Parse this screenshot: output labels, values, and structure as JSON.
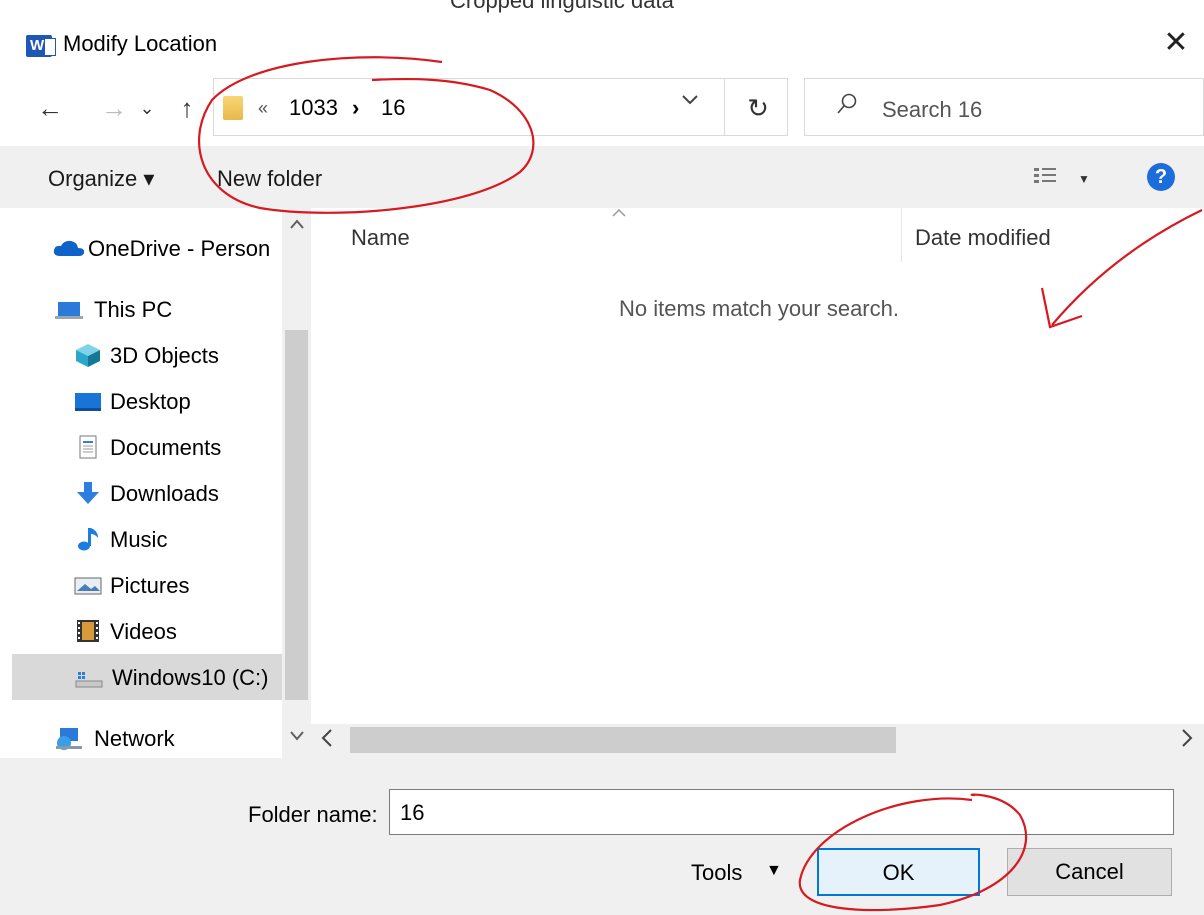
{
  "background": {
    "behind_text": "Cropped linguistic data"
  },
  "titlebar": {
    "title": "Modify Location",
    "app_icon": "word-icon",
    "close": "✕"
  },
  "nav": {
    "back": "←",
    "forward": "→",
    "recent": "⌄",
    "up": "↑",
    "breadcrumb": {
      "overflow": "«",
      "segment1": "1033",
      "separator": "›",
      "segment2": "16"
    },
    "dropdown": "⌄",
    "refresh": "↻",
    "search_placeholder": "Search 16"
  },
  "toolbar": {
    "organize": "Organize ▾",
    "new_folder": "New folder",
    "help": "?"
  },
  "sidebar": {
    "items": [
      {
        "label": "OneDrive - Person",
        "icon": "cloud-icon"
      },
      {
        "label": "This PC",
        "icon": "computer-icon"
      },
      {
        "label": "3D Objects",
        "icon": "cube-icon"
      },
      {
        "label": "Desktop",
        "icon": "desktop-icon"
      },
      {
        "label": "Documents",
        "icon": "documents-icon"
      },
      {
        "label": "Downloads",
        "icon": "download-icon"
      },
      {
        "label": "Music",
        "icon": "music-icon"
      },
      {
        "label": "Pictures",
        "icon": "pictures-icon"
      },
      {
        "label": "Videos",
        "icon": "videos-icon"
      },
      {
        "label": "Windows10 (C:)",
        "icon": "drive-icon"
      },
      {
        "label": "Network",
        "icon": "network-icon"
      }
    ],
    "selected": "Windows10 (C:)"
  },
  "content": {
    "columns": [
      "Name",
      "Date modified"
    ],
    "empty_message": "No items match your search."
  },
  "footer": {
    "folder_name_label": "Folder name:",
    "folder_name_value": "16",
    "tools_label": "Tools",
    "ok_label": "OK",
    "cancel_label": "Cancel"
  },
  "colors": {
    "annotation": "#d71920",
    "accent": "#0078d7",
    "help": "#1c6ddb"
  }
}
